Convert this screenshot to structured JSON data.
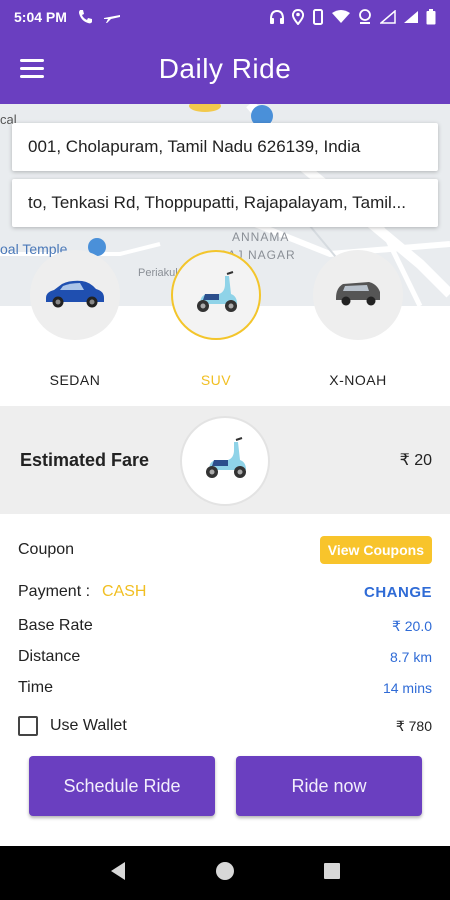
{
  "status_bar": {
    "time": "5:04 PM"
  },
  "app_bar": {
    "title": "Daily Ride"
  },
  "map": {
    "labels": [
      "cal",
      "oal Temple",
      "ANNAMA",
      "RAJ NAGAR",
      "Periakulam"
    ]
  },
  "addresses": {
    "pickup": "001, Cholapuram, Tamil Nadu 626139, India",
    "drop": "to, Tenkasi Rd, Thoppupatti, Rajapalayam, Tamil..."
  },
  "vehicles": [
    {
      "label": "SEDAN",
      "icon": "sedan-car-icon",
      "selected": false
    },
    {
      "label": "SUV",
      "icon": "scooter-icon",
      "selected": true
    },
    {
      "label": "X-NOAH",
      "icon": "van-icon",
      "selected": false
    }
  ],
  "fare": {
    "title": "Estimated Fare",
    "value": "₹ 20"
  },
  "details": {
    "coupon_label": "Coupon",
    "coupon_button": "View Coupons",
    "payment_label": "Payment :",
    "payment_method": "CASH",
    "change_label": "CHANGE",
    "base_rate_label": "Base Rate",
    "base_rate_value": "₹ 20.0",
    "distance_label": "Distance",
    "distance_value": "8.7 km",
    "time_label": "Time",
    "time_value": "14 mins",
    "wallet_label": "Use Wallet",
    "wallet_value": "₹ 780"
  },
  "actions": {
    "schedule": "Schedule Ride",
    "ride_now": "Ride now"
  },
  "colors": {
    "primary": "#6a3fc0",
    "accent": "#f8c42b",
    "link": "#2f6bd6"
  }
}
